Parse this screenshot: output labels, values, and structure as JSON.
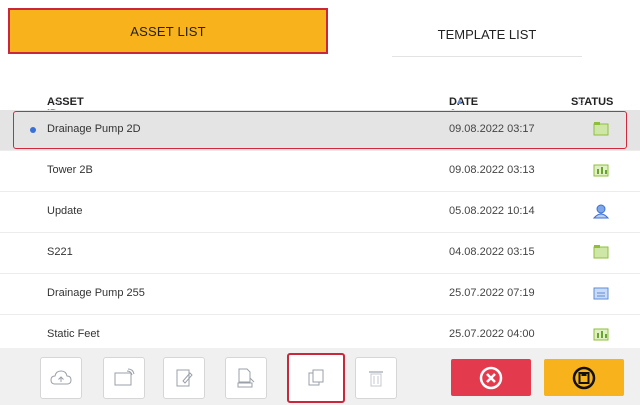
{
  "tabs": {
    "asset_list": "ASSET LIST",
    "template_list": "TEMPLATE LIST"
  },
  "columns": {
    "asset_id": "ASSET ID",
    "date_time": "DATE & TIME",
    "status": "STATUS"
  },
  "rows": [
    {
      "asset_id": "Drainage Pump 2D",
      "date_time": "09.08.2022 03:17",
      "status_icon": "folder-green-icon",
      "selected": true
    },
    {
      "asset_id": "Tower 2B",
      "date_time": "09.08.2022 03:13",
      "status_icon": "folder-chart-icon"
    },
    {
      "asset_id": "Update",
      "date_time": "05.08.2022 10:14",
      "status_icon": "person-blue-icon"
    },
    {
      "asset_id": "S221",
      "date_time": "04.08.2022 03:15",
      "status_icon": "folder-green-icon"
    },
    {
      "asset_id": "Drainage Pump 255",
      "date_time": "25.07.2022 07:19",
      "status_icon": "folder-blue-icon"
    },
    {
      "asset_id": "Static Feet",
      "date_time": "25.07.2022 04:00",
      "status_icon": "folder-chart-icon"
    }
  ],
  "colors": {
    "accent": "#f7b21c",
    "selection_border": "#c9273b",
    "cancel": "#e33b4d",
    "selected_row": "#e4e4e4"
  }
}
